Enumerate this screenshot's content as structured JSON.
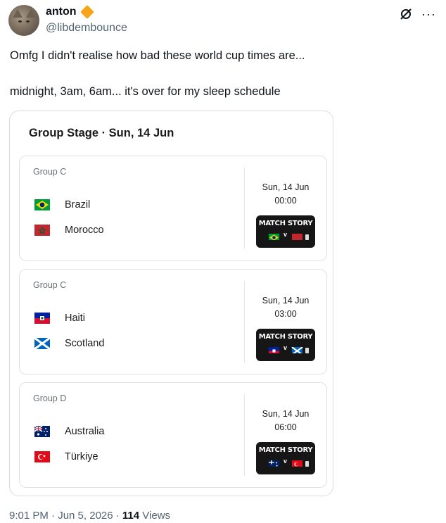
{
  "user": {
    "name": "anton",
    "handle": "@libdembounce"
  },
  "icons": {
    "grok": "grok-icon",
    "more": "more-icon",
    "verified": "verified-badge-icon"
  },
  "tweet": {
    "line1": "Omfg I didn't realise how bad these world cup times are...",
    "line2": "midnight, 3am, 6am... it's over for my sleep schedule"
  },
  "card": {
    "title": "Group Stage · Sun, 14 Jun",
    "story_label": "MATCH STORY",
    "story_v": "v",
    "matches": [
      {
        "group": "Group C",
        "home": "Brazil",
        "away": "Morocco",
        "date": "Sun, 14 Jun",
        "time": "00:00"
      },
      {
        "group": "Group C",
        "home": "Haiti",
        "away": "Scotland",
        "date": "Sun, 14 Jun",
        "time": "03:00"
      },
      {
        "group": "Group D",
        "home": "Australia",
        "away": "Türkiye",
        "date": "Sun, 14 Jun",
        "time": "06:00"
      }
    ]
  },
  "footer": {
    "time": "9:01 PM · Jun 5, 2026 · ",
    "views_count": "114",
    "views_label": " Views"
  },
  "colors": {
    "verified": "#f4a51c",
    "secondary_text": "#536471"
  }
}
